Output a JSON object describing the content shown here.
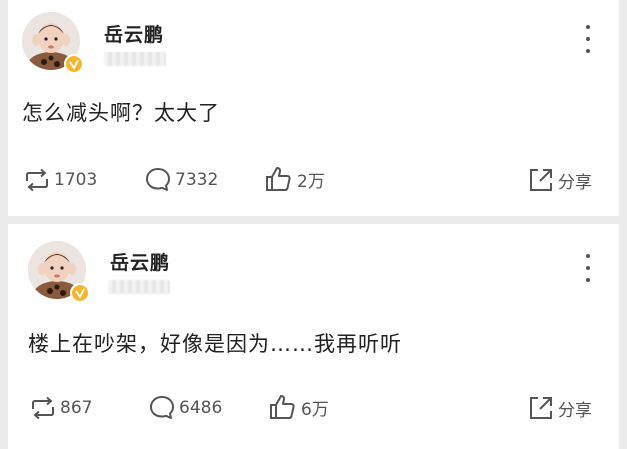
{
  "posts": [
    {
      "username": "岳云鹏",
      "text": "怎么减头啊？太大了",
      "reposts": "1703",
      "comments": "7332",
      "likes": "2万",
      "share_label": "分享"
    },
    {
      "username": "岳云鹏",
      "text": "楼上在吵架，好像是因为……我再听听",
      "reposts": "867",
      "comments": "6486",
      "likes": "6万",
      "share_label": "分享"
    }
  ],
  "icons": {
    "repost": "repost-icon",
    "comment": "comment-icon",
    "like": "thumbs-up-icon",
    "share": "share-icon",
    "more": "more-vertical-icon",
    "verified": "verified-badge-icon"
  },
  "colors": {
    "verified_badge": "#f7b52c",
    "background": "#ececec",
    "card": "#ffffff"
  }
}
